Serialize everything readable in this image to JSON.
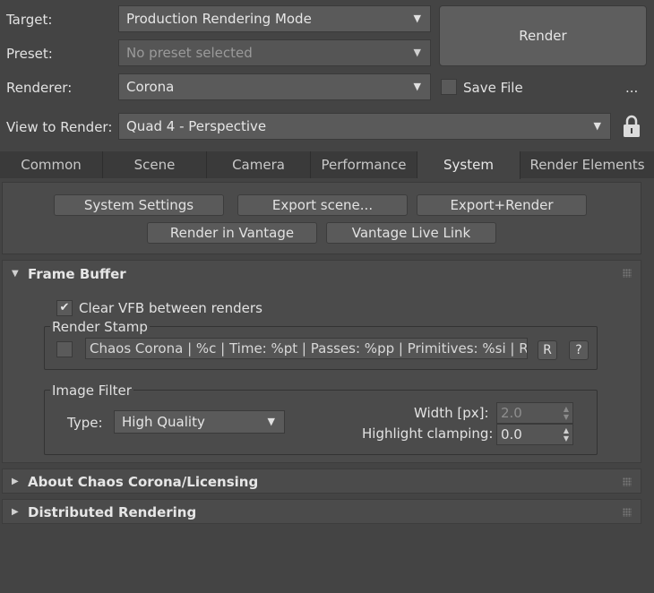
{
  "top": {
    "target_label": "Target:",
    "target_value": "Production Rendering Mode",
    "preset_label": "Preset:",
    "preset_value": "No preset selected",
    "renderer_label": "Renderer:",
    "renderer_value": "Corona",
    "view_label": "View to Render:",
    "view_value": "Quad 4 - Perspective",
    "render_button": "Render",
    "save_file_label": "Save File",
    "more_label": "...",
    "dropdown_arrow": "▼"
  },
  "tabs": [
    {
      "label": "Common"
    },
    {
      "label": "Scene"
    },
    {
      "label": "Camera"
    },
    {
      "label": "Performance"
    },
    {
      "label": "System"
    },
    {
      "label": "Render Elements"
    }
  ],
  "active_tab": "System",
  "system_buttons": {
    "system_settings": "System Settings",
    "export_scene": "Export scene...",
    "export_render": "Export+Render",
    "render_in_vantage": "Render in Vantage",
    "vantage_live_link": "Vantage Live Link"
  },
  "frame_buffer": {
    "title": "Frame Buffer",
    "clear_vfb_label": "Clear VFB between renders",
    "clear_vfb_checked": true,
    "check_glyph": "✔",
    "render_stamp_title": "Render Stamp",
    "render_stamp_text": "Chaos Corona | %c | Time: %pt | Passes: %pp | Primitives: %si | R",
    "r_button": "R",
    "help_button": "?",
    "image_filter_title": "Image Filter",
    "type_label": "Type:",
    "type_value": "High Quality",
    "width_label": "Width [px]:",
    "width_value": "2.0",
    "highlight_label": "Highlight clamping:",
    "highlight_value": "0.0"
  },
  "rollouts": {
    "about": "About Chaos Corona/Licensing",
    "distributed": "Distributed Rendering",
    "expand_glyph": "▶",
    "collapse_glyph": "▼"
  }
}
